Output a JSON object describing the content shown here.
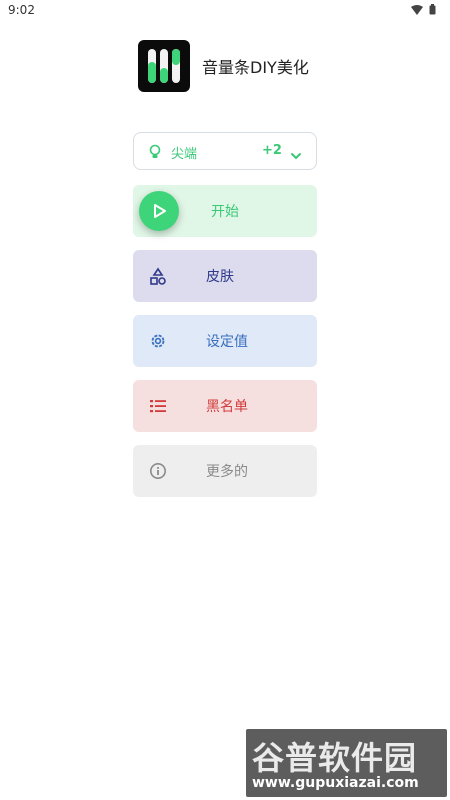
{
  "status_bar": {
    "time": "9:02"
  },
  "app": {
    "title": "音量条DIY美化"
  },
  "mode_select": {
    "label": "尖端",
    "count": "+2"
  },
  "buttons": {
    "start": "开始",
    "skin": "皮肤",
    "settings": "设定值",
    "blacklist": "黑名单",
    "more": "更多的"
  },
  "icons": {
    "mode": "lightbulb-icon",
    "dropdown": "chevron-down-icon",
    "start": "play-icon",
    "skin": "shapes-icon",
    "settings": "gear-icon",
    "blacklist": "list-icon",
    "more": "info-icon"
  },
  "colors": {
    "green": "#39c977",
    "indigo": "#2f3a8a",
    "blue": "#3a6fbf",
    "red": "#d23b3b",
    "gray": "#8a8a8a"
  },
  "watermark": {
    "title": "谷普软件园",
    "url": "www.gupuxiazai.com"
  }
}
